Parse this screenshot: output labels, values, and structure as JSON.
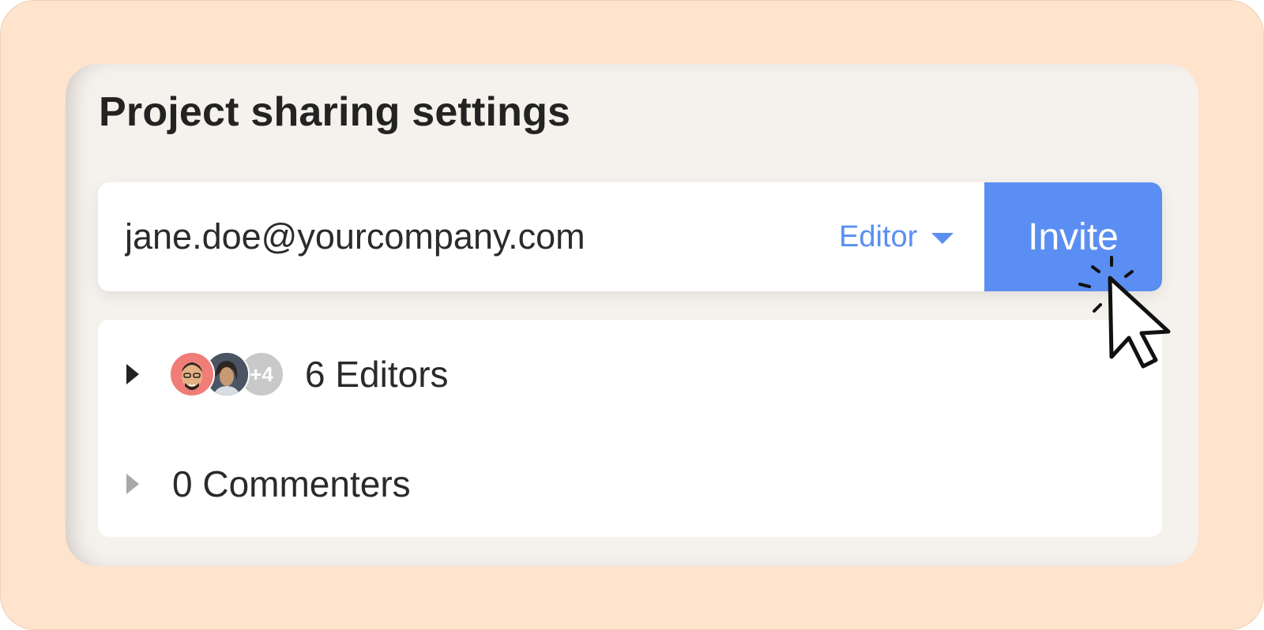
{
  "title": "Project sharing settings",
  "invite": {
    "email_value": "jane.doe@yourcompany.com",
    "role_selected": "Editor",
    "button_label": "Invite"
  },
  "groups": {
    "editors": {
      "label": "6 Editors",
      "avatar_overflow": "+4"
    },
    "commenters": {
      "label": "0 Commenters"
    }
  },
  "icons": {
    "role_dropdown": "chevron-down-icon",
    "expand": "caret-right-icon",
    "pointer": "mouse-pointer-icon"
  },
  "colors": {
    "accent": "#5b8ef2",
    "background": "#fee3cd",
    "card": "#f5f1ed"
  }
}
